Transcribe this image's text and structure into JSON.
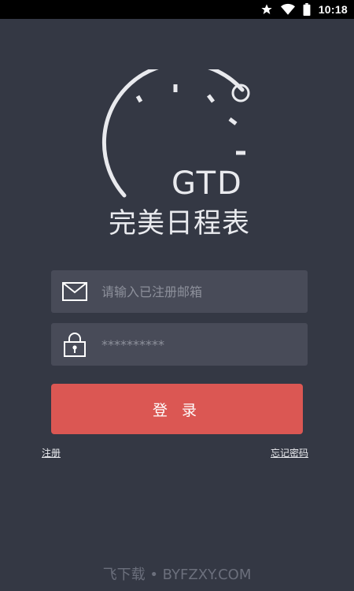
{
  "status_bar": {
    "time": "10:18",
    "icons": [
      "star-icon",
      "wifi-icon",
      "battery-icon"
    ]
  },
  "logo": {
    "title": "GTD",
    "subtitle": "完美日程表"
  },
  "email_field": {
    "placeholder": "请输入已注册邮箱",
    "icon": "envelope-icon"
  },
  "password_field": {
    "value": "**********",
    "icon": "lock-icon"
  },
  "login_button": {
    "label": "登 录"
  },
  "links": {
    "register": "注册",
    "forgot_password": "忘记密码"
  },
  "watermark": "飞下载 • BYFZXY.COM",
  "colors": {
    "background": "#343844",
    "field_background": "#484b58",
    "accent": "#db5753",
    "text": "#e9eaee"
  }
}
